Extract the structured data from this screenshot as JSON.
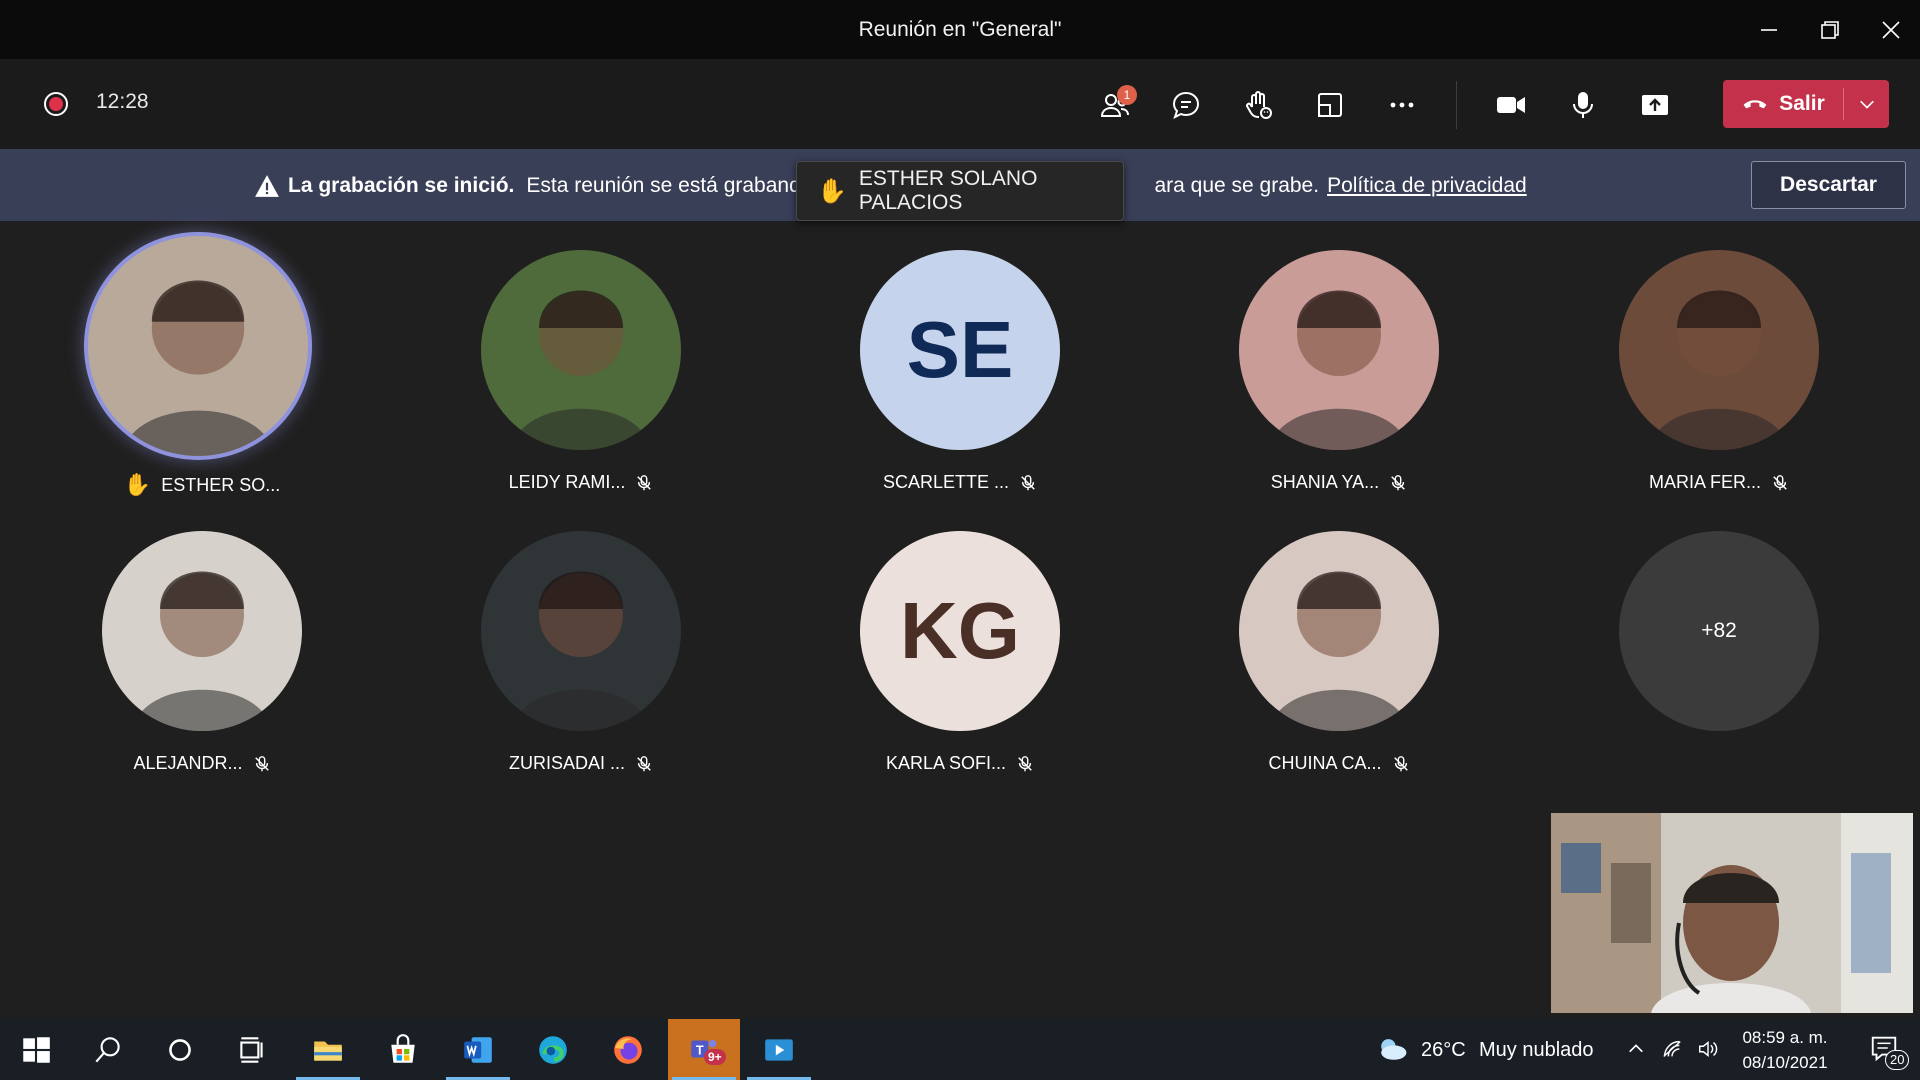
{
  "window": {
    "title": "Reunión en \"General\""
  },
  "toolbar": {
    "timer": "12:28",
    "participants_badge": "1",
    "leave_label": "Salir"
  },
  "banner": {
    "title": "La grabación se inició.",
    "text_left": "Esta reunión se está grabando",
    "text_right": "ara que se grabe.",
    "link": "Política de privacidad",
    "dismiss": "Descartar"
  },
  "raised_hand_tooltip": "ESTHER SOLANO PALACIOS",
  "participants": [
    {
      "name": "ESTHER SO...",
      "hand": true,
      "muted": false,
      "speaking": true,
      "initials": "",
      "color": "#b9a99b"
    },
    {
      "name": "LEIDY RAMI...",
      "hand": false,
      "muted": true,
      "speaking": false,
      "initials": "",
      "color": "#4f6a3b"
    },
    {
      "name": "SCARLETTE ...",
      "hand": false,
      "muted": true,
      "speaking": false,
      "initials": "SE",
      "color": "#c5d3ec",
      "text_color": "#0f2a57"
    },
    {
      "name": "SHANIA YA...",
      "hand": false,
      "muted": true,
      "speaking": false,
      "initials": "",
      "color": "#c99c98"
    },
    {
      "name": "MARIA FER...",
      "hand": false,
      "muted": true,
      "speaking": false,
      "initials": "",
      "color": "#6d4b3a"
    },
    {
      "name": "ALEJANDR...",
      "hand": false,
      "muted": true,
      "speaking": false,
      "initials": "",
      "color": "#d6d2cb"
    },
    {
      "name": "ZURISADAI ...",
      "hand": false,
      "muted": true,
      "speaking": false,
      "initials": "",
      "color": "#2f3437"
    },
    {
      "name": "KARLA SOFI...",
      "hand": false,
      "muted": true,
      "speaking": false,
      "initials": "KG",
      "color": "#ece0dc",
      "text_color": "#4a2f26"
    },
    {
      "name": "CHUINA CA...",
      "hand": false,
      "muted": true,
      "speaking": false,
      "initials": "",
      "color": "#d7c8c2"
    }
  ],
  "overflow": {
    "label": "+82"
  },
  "taskbar": {
    "teams_badge": "9+",
    "weather_temp": "26°C",
    "weather_text": "Muy nublado",
    "time": "08:59 a. m.",
    "date": "08/10/2021",
    "notifications": "20"
  },
  "colors": {
    "accent": "#c4314b",
    "banner": "#3a3f58",
    "speaking_ring": "#8f93dd"
  }
}
